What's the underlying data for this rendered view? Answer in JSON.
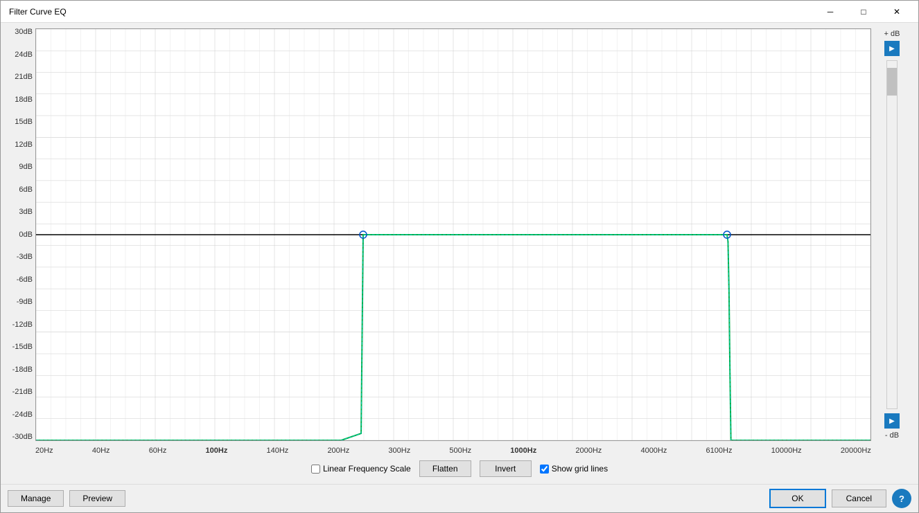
{
  "window": {
    "title": "Filter Curve EQ",
    "min_btn": "─",
    "max_btn": "□",
    "close_btn": "✕"
  },
  "yAxis": {
    "labels": [
      "30dB",
      "24dB",
      "21dB",
      "18dB",
      "15dB",
      "12dB",
      "9dB",
      "6dB",
      "3dB",
      "0dB",
      "-3dB",
      "-6dB",
      "-9dB",
      "-12dB",
      "-15dB",
      "-18dB",
      "-21dB",
      "-24dB",
      "-30dB"
    ],
    "topLabel": "+ dB",
    "bottomLabel": "- dB"
  },
  "xAxis": {
    "labels": [
      {
        "text": "20Hz",
        "bold": false
      },
      {
        "text": "40Hz",
        "bold": false
      },
      {
        "text": "60Hz",
        "bold": false
      },
      {
        "text": "100Hz",
        "bold": true
      },
      {
        "text": "140Hz",
        "bold": false
      },
      {
        "text": "200Hz",
        "bold": false
      },
      {
        "text": "300Hz",
        "bold": false
      },
      {
        "text": "500Hz",
        "bold": false
      },
      {
        "text": "1000Hz",
        "bold": true
      },
      {
        "text": "2000Hz",
        "bold": false
      },
      {
        "text": "4000Hz",
        "bold": false
      },
      {
        "text": "6100Hz",
        "bold": false
      },
      {
        "text": "10000Hz",
        "bold": false
      },
      {
        "text": "20000Hz",
        "bold": false
      }
    ]
  },
  "options": {
    "linearFreqLabel": "Linear Frequency Scale",
    "linearFreqChecked": false,
    "flattenLabel": "Flatten",
    "invertLabel": "Invert",
    "showGridLabel": "Show grid lines",
    "showGridChecked": true
  },
  "bottomBar": {
    "manageLabel": "Manage",
    "previewLabel": "Preview",
    "okLabel": "OK",
    "cancelLabel": "Cancel",
    "helpLabel": "?"
  },
  "curve": {
    "color": "#00aa44",
    "overlayColor": "#4488ff"
  }
}
